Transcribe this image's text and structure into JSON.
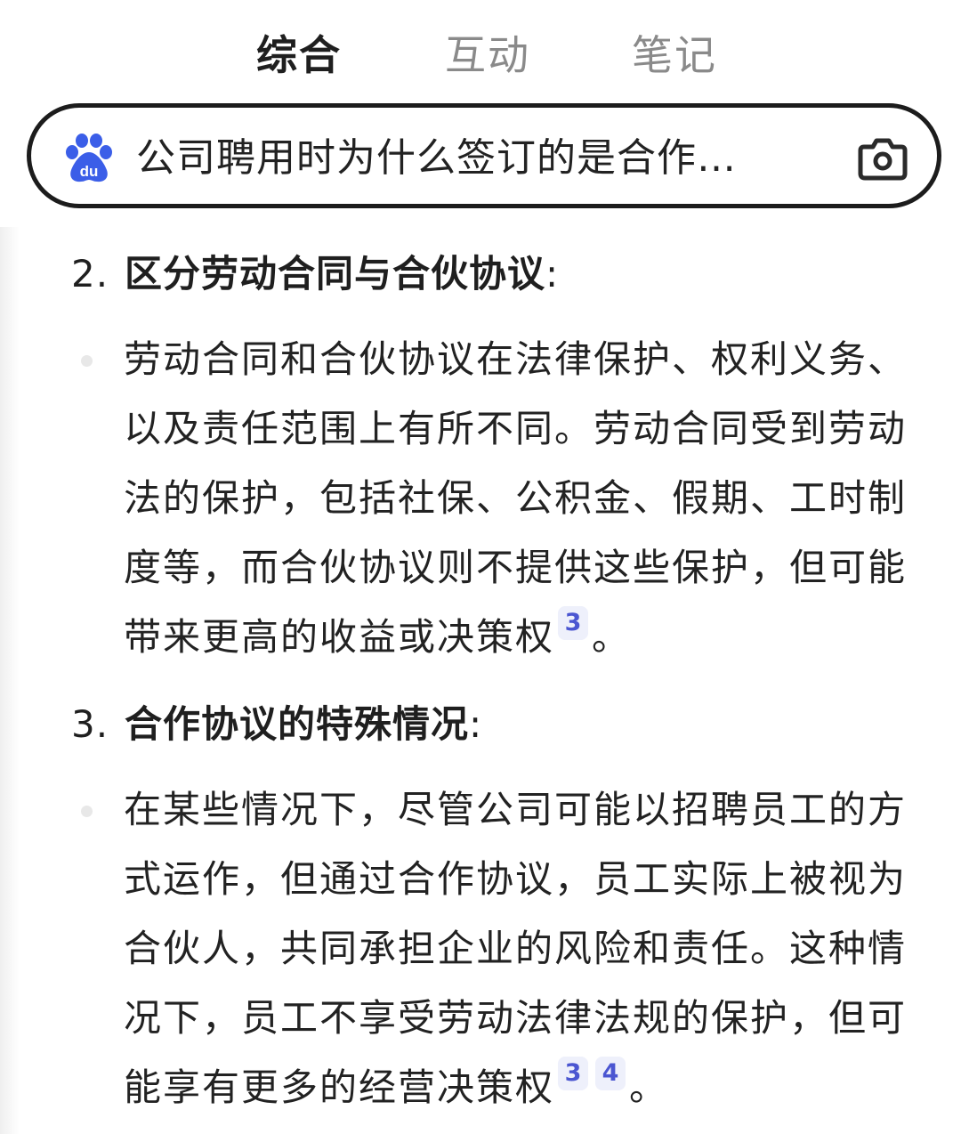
{
  "tabs": [
    {
      "label": "综合",
      "active": true
    },
    {
      "label": "互动",
      "active": false
    },
    {
      "label": "笔记",
      "active": false
    }
  ],
  "search": {
    "query": "公司聘用时为什么签订的是合作…",
    "logo_icon": "baidu-paw-icon",
    "camera_icon": "camera-icon",
    "logo_text": "du"
  },
  "sections": [
    {
      "number": "2.",
      "title": "区分劳动合同与合伙协议",
      "colon": ":",
      "text": "劳动合同和合伙协议在法律保护、权利义务、以及责任范围上有所不同。劳动合同受到劳动法的保护，包括社保、公积金、假期、工时制度等，而合伙协议则不提供这些保护，但可能带来更高的收益或决策权",
      "refs": [
        "3"
      ],
      "end": "。"
    },
    {
      "number": "3.",
      "title": "合作协议的特殊情况",
      "colon": ":",
      "text": "在某些情况下，尽管公司可能以招聘员工的方式运作，但通过合作协议，员工实际上被视为合伙人，共同承担企业的风险和责任。这种情况下，员工不享受劳动法律法规的保护，但可能享有更多的经营决策权",
      "refs": [
        "3",
        "4"
      ],
      "end": "。"
    }
  ],
  "colors": {
    "accent": "#4b56d1",
    "logo": "#3b5ee8"
  }
}
